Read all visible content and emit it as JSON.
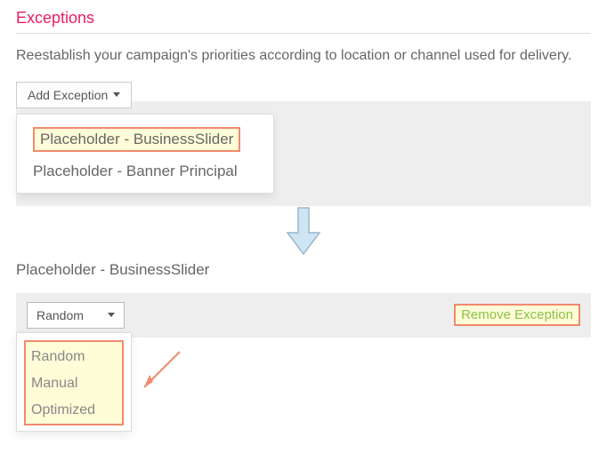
{
  "heading": "Exceptions",
  "description": "Reestablish your campaign's priorities according to location or channel used for delivery.",
  "addExceptionBtn": "Add Exception",
  "placeholderMenu": {
    "items": [
      "Placeholder - BusinessSlider",
      "Placeholder - Banner Principal"
    ]
  },
  "section2": {
    "title": "Placeholder - BusinessSlider",
    "selectValue": "Random",
    "removeLabel": "Remove Exception",
    "options": [
      "Random",
      "Manual",
      "Optimized"
    ]
  },
  "colors": {
    "accent": "#E91E63",
    "highlightBg": "#FFFDD8",
    "highlightBorder": "#F08A6E",
    "linkGreen": "#8BC34A",
    "arrowFill": "#CFE5F3",
    "arrowStroke": "#9CB7CC",
    "pointerArrow": "#F08A6E"
  }
}
